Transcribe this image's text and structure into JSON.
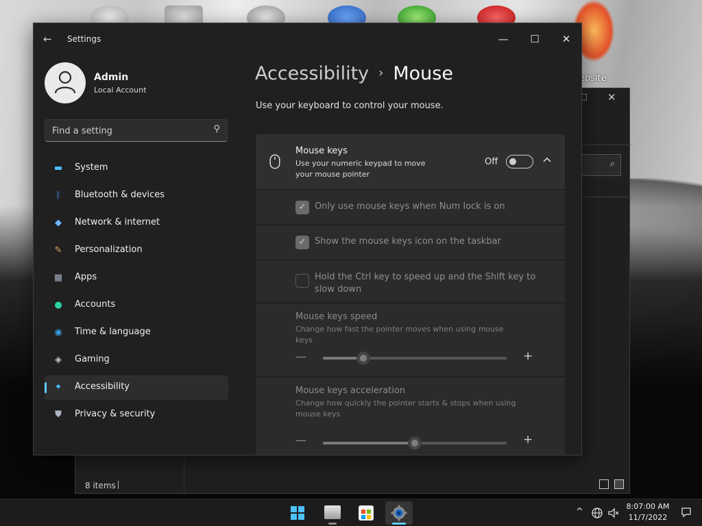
{
  "window": {
    "title": "Settings",
    "back_icon": "back-arrow-icon",
    "controls": {
      "minimize": "—",
      "maximize": "☐",
      "close": "✕"
    }
  },
  "user": {
    "name": "Admin",
    "account_type": "Local Account"
  },
  "search": {
    "placeholder": "Find a setting",
    "icon": "search-icon"
  },
  "nav": [
    {
      "label": "System",
      "icon": "monitor-icon",
      "color": "#4cc2ff"
    },
    {
      "label": "Bluetooth & devices",
      "icon": "bluetooth-icon",
      "color": "#3a8fe8"
    },
    {
      "label": "Network & internet",
      "icon": "wifi-icon",
      "color": "#6ab7ff"
    },
    {
      "label": "Personalization",
      "icon": "brush-icon",
      "color": "#e0a86b"
    },
    {
      "label": "Apps",
      "icon": "apps-icon",
      "color": "#a6b0c3"
    },
    {
      "label": "Accounts",
      "icon": "person-icon",
      "color": "#2bd1a2"
    },
    {
      "label": "Time & language",
      "icon": "globe-clock-icon",
      "color": "#3aa0e8"
    },
    {
      "label": "Gaming",
      "icon": "gamepad-icon",
      "color": "#c4c4c4"
    },
    {
      "label": "Accessibility",
      "icon": "accessibility-icon",
      "color": "#4cc2ff",
      "selected": true
    },
    {
      "label": "Privacy & security",
      "icon": "shield-icon",
      "color": "#b0b7c4"
    }
  ],
  "breadcrumb": {
    "parent": "Accessibility",
    "separator": "›",
    "current": "Mouse"
  },
  "description": "Use your keyboard to control your mouse.",
  "mouse_keys": {
    "title": "Mouse keys",
    "subtitle": "Use your numeric keypad to move your mouse pointer",
    "state_label": "Off",
    "enabled": false,
    "expanded": true,
    "options": [
      {
        "label": "Only use mouse keys when Num lock is on",
        "checked": true
      },
      {
        "label": "Show the mouse keys icon on the taskbar",
        "checked": true
      },
      {
        "label": "Hold the Ctrl key to speed up and the Shift key to slow down",
        "checked": false
      }
    ],
    "speed": {
      "title": "Mouse keys speed",
      "subtitle": "Change how fast the pointer moves when using mouse keys",
      "value_fraction": 0.22
    },
    "acceleration": {
      "title": "Mouse keys acceleration",
      "subtitle": "Change how quickly the pointer starts & stops when using mouse keys",
      "value_fraction": 0.5
    },
    "minus": "—",
    "plus": "+"
  },
  "background_window": {
    "status_items": "8 items",
    "desktop_label": "ebsite",
    "close": "✕"
  },
  "taskbar": {
    "apps": [
      {
        "name": "start",
        "icon": "windows-logo-icon"
      },
      {
        "name": "file-explorer",
        "icon": "folder-icon"
      },
      {
        "name": "microsoft-store",
        "icon": "store-icon"
      },
      {
        "name": "settings",
        "icon": "gear-icon",
        "active": true
      }
    ],
    "tray": {
      "chevron": "^"
    },
    "time": "8:07:00 AM",
    "date": "11/7/2022"
  },
  "colors": {
    "accent": "#60cdff",
    "window_bg": "#202020",
    "card_bg": "#2b2b2b"
  }
}
